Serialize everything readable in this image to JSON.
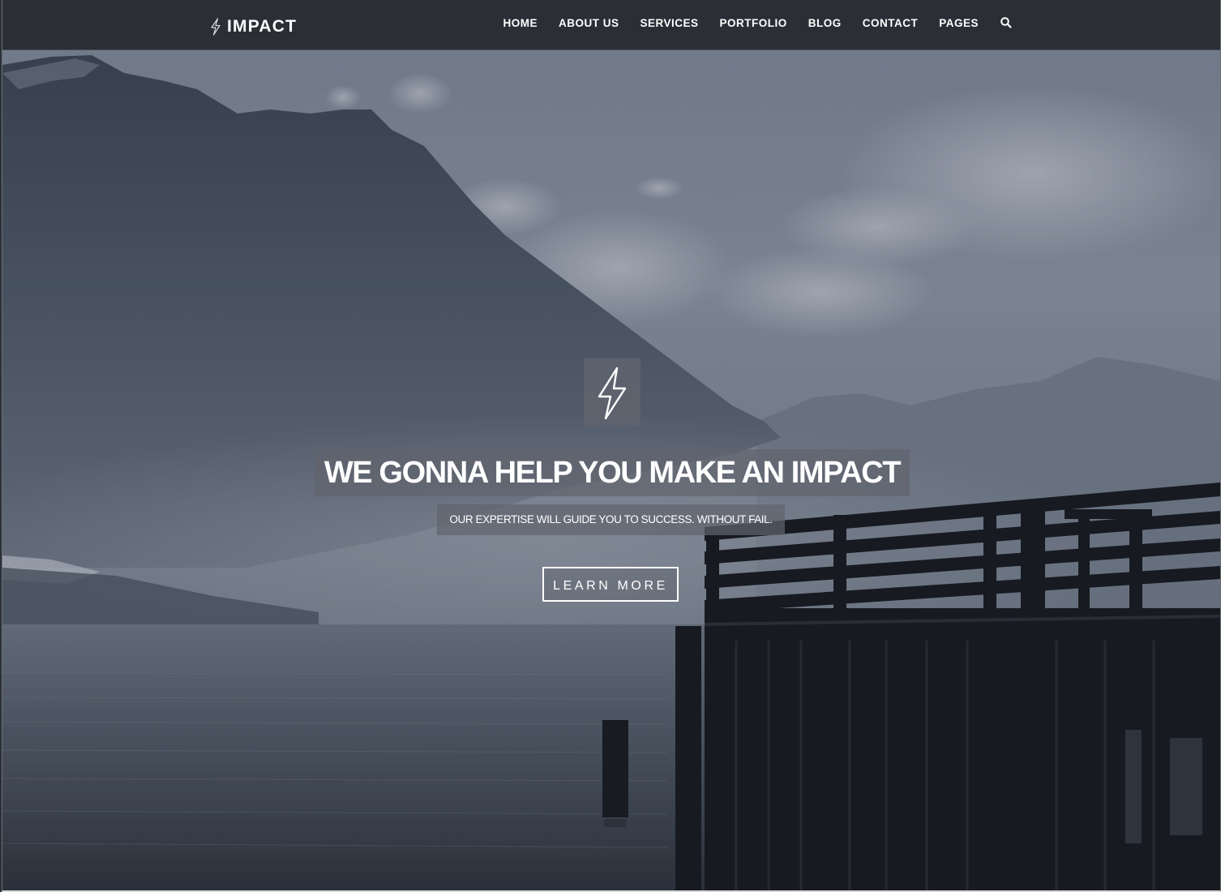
{
  "brand": {
    "name": "IMPACT",
    "icon": "lightning-bolt-icon"
  },
  "nav": {
    "items": [
      {
        "label": "HOME"
      },
      {
        "label": "ABOUT US"
      },
      {
        "label": "SERVICES"
      },
      {
        "label": "PORTFOLIO"
      },
      {
        "label": "BLOG"
      },
      {
        "label": "CONTACT"
      },
      {
        "label": "PAGES"
      }
    ],
    "search_icon": "search-icon"
  },
  "hero": {
    "icon": "lightning-bolt-icon",
    "title": "WE GONNA HELP YOU MAKE AN IMPACT",
    "subtitle": "OUR EXPERTISE WILL GUIDE YOU TO SUCCESS. WITHOUT FAIL.",
    "cta_label": "LEARN MORE",
    "background": "mountain-lake-pier-photo"
  },
  "colors": {
    "navbar": "#2b2e35",
    "text": "#ffffff",
    "overlay_box": "#5f646e"
  }
}
